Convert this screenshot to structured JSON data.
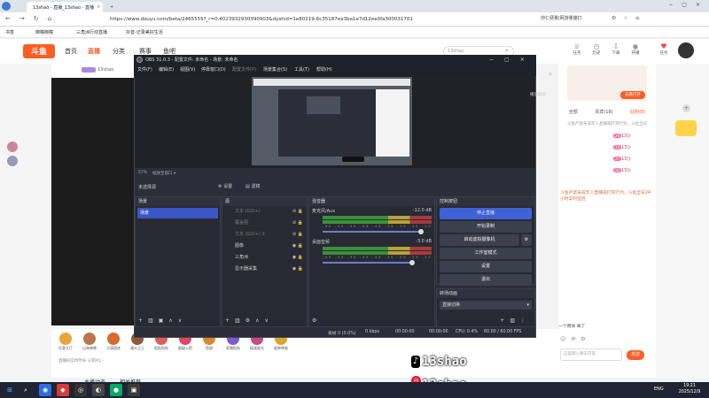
{
  "browser": {
    "tabs": [
      {
        "label": "13shao - 直播_13shao - 直播",
        "active": true
      },
      {
        "label": "OBS Studio 下载",
        "active": false
      }
    ],
    "url": "https://www.douyu.com/beta/2465555?_r=0.4023932930390903&dyshid=1e80119-6c35187ee3ba1e7d12ee0fa300031701",
    "right_text": "你仁便量|网游量猫打",
    "bookmarks": [
      "书签",
      "御瞳御瞳",
      "三角洲行动直播",
      "抖音-记录美好生活"
    ]
  },
  "douyu": {
    "logo": "斗鱼",
    "nav": [
      "首页",
      "直播",
      "分类",
      "赛事",
      "鱼吧"
    ],
    "search_placeholder": "13shao",
    "header_icons": [
      {
        "icon": "trophy-icon",
        "label": "任务"
      },
      {
        "icon": "history-icon",
        "label": "历史"
      },
      {
        "icon": "download-icon",
        "label": "下载"
      },
      {
        "icon": "broadcast-icon",
        "label": "开播"
      },
      {
        "icon": "gift-icon",
        "label": "任务"
      }
    ],
    "anchor_name": "13shao",
    "right_card": {
      "button": "去看打开"
    },
    "chat_tabs": [
      "全部",
      "贵宾(18)",
      "钻粉(8)"
    ],
    "chat_notice": "斗鱼严禁未成年人直播或打赏行为，斗鱼全日24小时实时监控",
    "chat_lines": [
      {
        "lvl": "28",
        "name": "13ひ"
      },
      {
        "lvl": "30",
        "name": "13ひ"
      },
      {
        "lvl": "27",
        "name": "13ひ"
      },
      {
        "lvl": "28",
        "name": "13ひ"
      }
    ],
    "chat_last": "一个周帅 来了",
    "chat_input_placeholder": "这里输入聊天内容",
    "send_label": "发送",
    "gifts": [
      "任意大厅",
      "山海神兽",
      "沙漠遗迹",
      "满头之王",
      "贴贴贴贴",
      "超级火箭",
      "鱼翅",
      "直播贴贴",
      "极速星光",
      "超神降临"
    ],
    "live_notice": "直播间实时时长 火箭X1 ›",
    "tabs_bottom": [
      "主播动态",
      "相关推荐"
    ]
  },
  "obs": {
    "title": "OBS 31.0.3 - 配置文件: 未命名 - 场景: 未命名",
    "menu": [
      "文件(F)",
      "编辑(E)",
      "视图(V)",
      "停靠窗口(D)",
      "配置文件(P)",
      "场景集合(S)",
      "工具(T)",
      "帮助(H)"
    ],
    "zoom": "57%",
    "zoom_mode": "缩放至窗口",
    "selected_source": "未选择源",
    "props_btn": "设置",
    "filters_btn": "滤镜",
    "docks": {
      "scenes": "场景",
      "sources": "源",
      "mixer": "混音器",
      "controls": "控制按钮",
      "transitions": "转场动画"
    },
    "scenes_list": [
      "场景"
    ],
    "sources_list": [
      "文本 (GDI+)",
      "覆盖图",
      "文本 (GDI+) 3",
      "图像",
      "三角洲",
      "显示器采集"
    ],
    "mixer": [
      {
        "name": "麦克风/Aux",
        "db": "-12.0 dB"
      },
      {
        "name": "桌面音频",
        "db": "-3.0 dB"
      }
    ],
    "meter_scale": "-60 -55 -50 -45 -40 -35 -30 -25 -20 -15 -10 -5 0",
    "controls": [
      "停止直播",
      "开始录制",
      "启动虚拟摄像机",
      "工作室模式",
      "设置",
      "退出"
    ],
    "transition": "直接切换",
    "status": {
      "dropped": "丢帧 0 (0.0%)",
      "kbps": "0 kbps",
      "rec_time": "00:00:00",
      "live_time": "00:00:00",
      "cpu": "CPU: 0.4%",
      "fps": "60.00 / 60.00 FPS"
    },
    "side_label": "播放器窗"
  },
  "watermark": {
    "line1": "13shao",
    "line2": "13shao、"
  },
  "taskbar": {
    "lang": "ENG",
    "time": "19:21",
    "date": "2025/12/9"
  }
}
